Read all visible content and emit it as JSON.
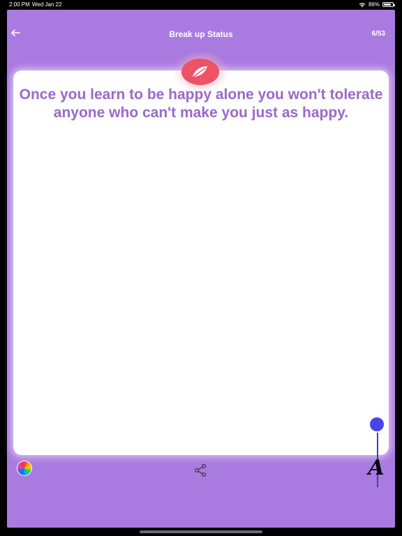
{
  "status_bar": {
    "time": "2:00 PM",
    "date": "Wed Jan 22",
    "battery": "86%",
    "battery_level": 0.86
  },
  "header": {
    "back_icon": "arrow-left-icon",
    "title": "Break up Status",
    "counter": "6/53"
  },
  "quote": {
    "text": "Once you learn to be happy alone you won't tolerate anyone who can't make you just as happy."
  },
  "category_badge": {
    "icon": "feather-icon",
    "color": "#ee5267"
  },
  "toolbar": {
    "color_icon": "color-wheel-icon",
    "share_icon": "share-icon",
    "font_icon": "font-icon",
    "font_label": "A"
  },
  "colors": {
    "background": "#a97ae0",
    "quote_text": "#9a69c9",
    "slider": "#4646e8"
  }
}
